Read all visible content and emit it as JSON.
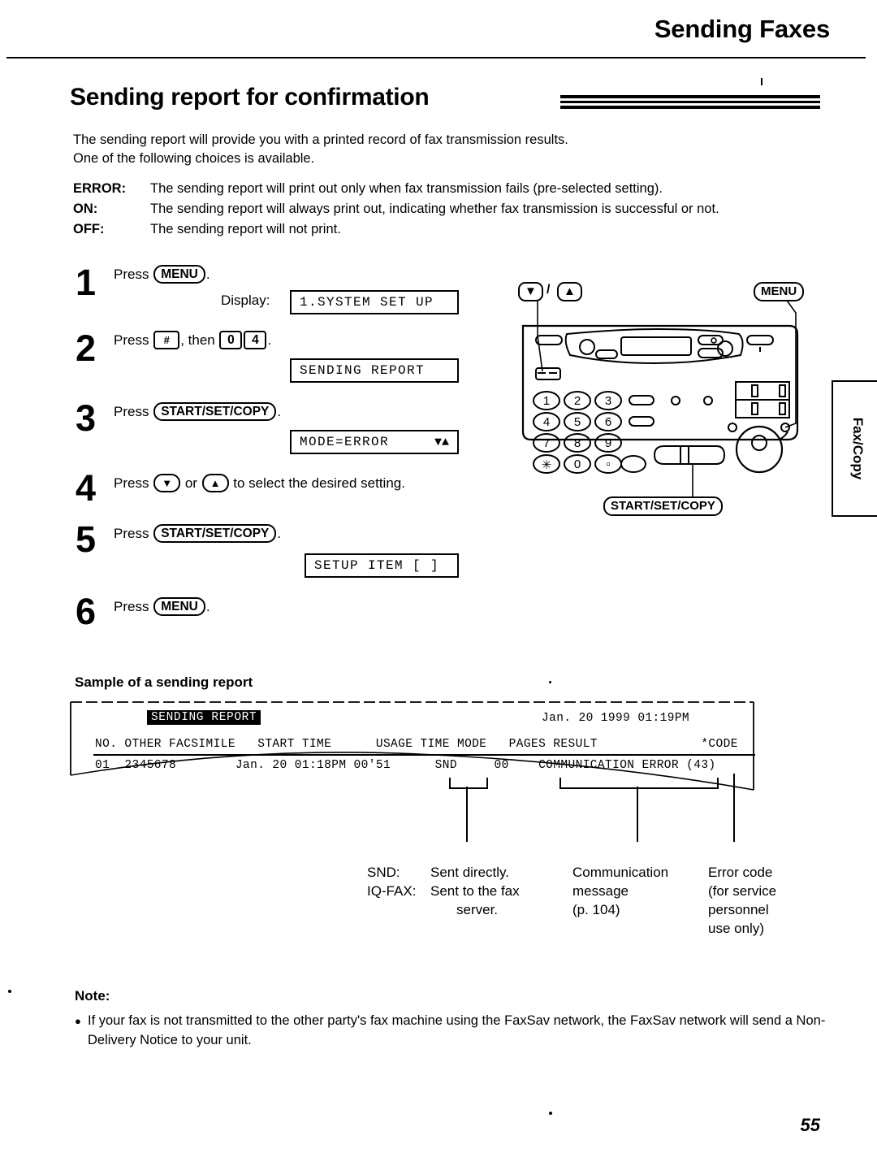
{
  "header": {
    "running_title": "Sending Faxes",
    "section_title": "Sending report for confirmation"
  },
  "intro": {
    "line1": "The sending report will provide you with a printed record of fax transmission results.",
    "line2": "One of the following choices is available."
  },
  "choices": [
    {
      "key": "ERROR:",
      "text": "The sending report will print out only when fax transmission fails (pre-selected setting)."
    },
    {
      "key": "ON:",
      "text": "The sending report will always print out, indicating whether fax transmission is successful or not."
    },
    {
      "key": "OFF:",
      "text": "The sending report will not print."
    }
  ],
  "steps": {
    "display_label": "Display:",
    "s1": {
      "num": "1",
      "press": "Press",
      "key": "MENU",
      "period": ".",
      "lcd": "1.SYSTEM SET UP"
    },
    "s2": {
      "num": "2",
      "press": "Press",
      "key1": "#",
      "mid": ", then",
      "key2": "0",
      "key3": "4",
      "period": ".",
      "lcd": "SENDING REPORT"
    },
    "s3": {
      "num": "3",
      "press": "Press",
      "key": "START/SET/COPY",
      "period": ".",
      "lcd": "MODE=ERROR",
      "lcd_arrows": "▼▲"
    },
    "s4": {
      "num": "4",
      "press": "Press",
      "key1": "▼",
      "mid": "or",
      "key2": "▲",
      "tail": "to select the desired setting."
    },
    "s5": {
      "num": "5",
      "press": "Press",
      "key": "START/SET/COPY",
      "period": ".",
      "lcd": "SETUP ITEM [   ]"
    },
    "s6": {
      "num": "6",
      "press": "Press",
      "key": "MENU",
      "period": "."
    }
  },
  "figure": {
    "label_updown": "▼",
    "label_updown_sep": "/",
    "label_updown2": "▲",
    "label_menu": "MENU",
    "label_start": "START/SET/COPY",
    "keypad": [
      "1",
      "2",
      "3",
      "4",
      "5",
      "6",
      "7",
      "8",
      "9",
      "*",
      "0",
      "▫"
    ]
  },
  "side_tab": {
    "label": "Fax/Copy"
  },
  "sample": {
    "heading": "Sample of a sending report",
    "report_title": "SENDING REPORT",
    "date": "Jan. 20 1999 01:19PM",
    "columns_line": "NO. OTHER FACSIMILE   START TIME      USAGE TIME MODE   PAGES RESULT              *CODE",
    "row_line": "01  2345678        Jan. 20 01:18PM 00'51      SND     00    COMMUNICATION ERROR (43)",
    "columns": [
      "NO.",
      "OTHER FACSIMILE",
      "START TIME",
      "USAGE TIME",
      "MODE",
      "PAGES",
      "RESULT",
      "*CODE"
    ],
    "row": {
      "no": "01",
      "other_facsimile": "2345678",
      "start_time": "Jan. 20 01:18PM",
      "usage_time": "00'51",
      "mode": "SND",
      "pages": "00",
      "result": "COMMUNICATION ERROR",
      "code": "(43)"
    }
  },
  "callouts": {
    "mode": {
      "k1": "SND:",
      "v1": "Sent directly.",
      "k2": "IQ-FAX:",
      "v2": "Sent to the fax",
      "v2b": "server."
    },
    "result": {
      "l1": "Communication",
      "l2": "message",
      "l3": "(p. 104)"
    },
    "code": {
      "l1": "Error code",
      "l2": "(for service",
      "l3": "personnel",
      "l4": "use only)"
    }
  },
  "note": {
    "title": "Note:",
    "bullet": "If your fax is not transmitted to the other party's fax machine using the FaxSav network, the FaxSav network will send a Non-Delivery Notice to your unit."
  },
  "footer": {
    "page_number": "55"
  }
}
